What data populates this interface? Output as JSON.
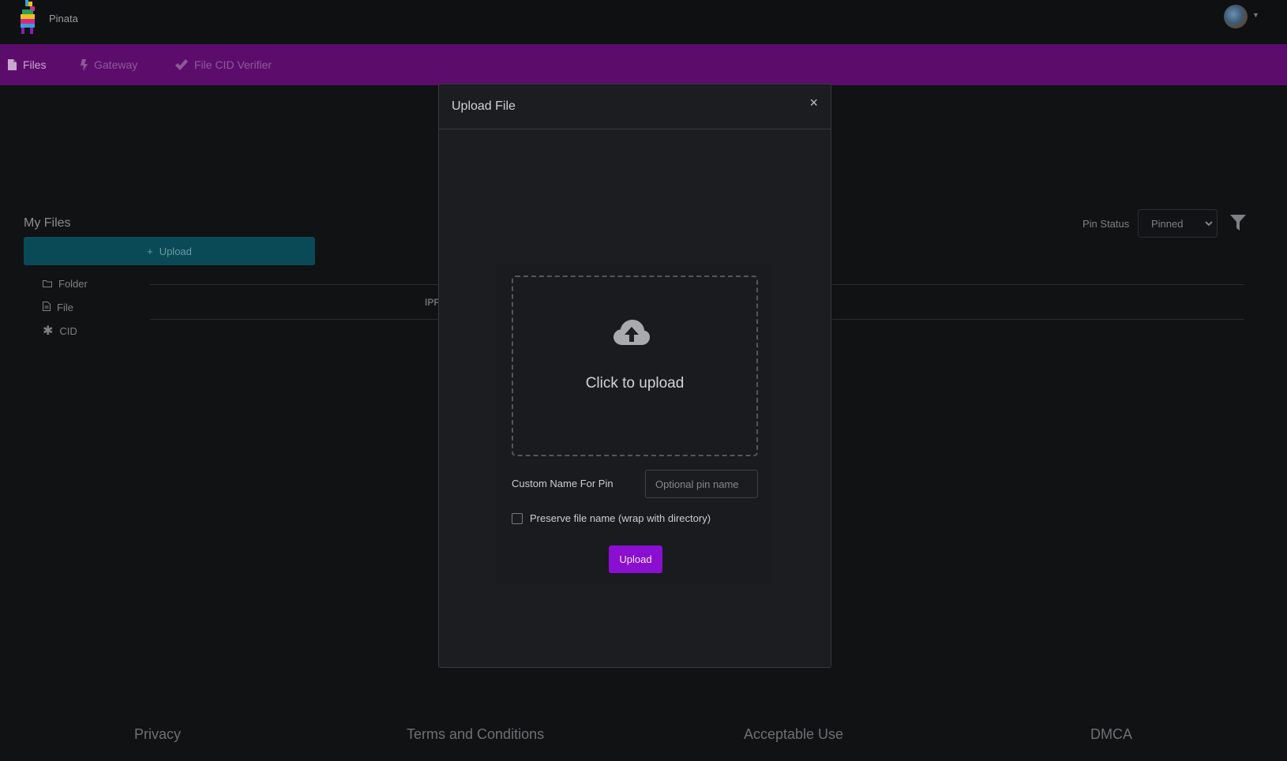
{
  "app": {
    "brand": "Pinata"
  },
  "nav": {
    "items": [
      {
        "label": "Files",
        "icon": "file-icon"
      },
      {
        "label": "Gateway",
        "icon": "bolt-icon"
      },
      {
        "label": "File CID Verifier",
        "icon": "double-check-icon"
      }
    ]
  },
  "sidebar": {
    "title": "My Files",
    "upload_label": "Upload",
    "items": [
      {
        "label": "Folder",
        "icon": "folder-icon"
      },
      {
        "label": "File",
        "icon": "file-icon"
      },
      {
        "label": "CID",
        "icon": "asterisk-icon"
      }
    ]
  },
  "table": {
    "partial_header": "IPF"
  },
  "filters": {
    "pin_status_label": "Pin Status",
    "pin_status_value": "Pinned"
  },
  "modal": {
    "title": "Upload File",
    "close_glyph": "×",
    "dropzone_text": "Click to upload",
    "custom_name_label": "Custom Name For Pin",
    "custom_name_placeholder": "Optional pin name",
    "preserve_label": "Preserve file name (wrap with directory)",
    "preserve_checked": false,
    "submit_label": "Upload"
  },
  "footer": {
    "links": [
      "Privacy",
      "Terms and Conditions",
      "Acceptable Use",
      "DMCA"
    ]
  },
  "colors": {
    "accent": "#8a0fd0",
    "nav_bg": "#5c0d6c",
    "upload_bar": "#0a4a57"
  }
}
